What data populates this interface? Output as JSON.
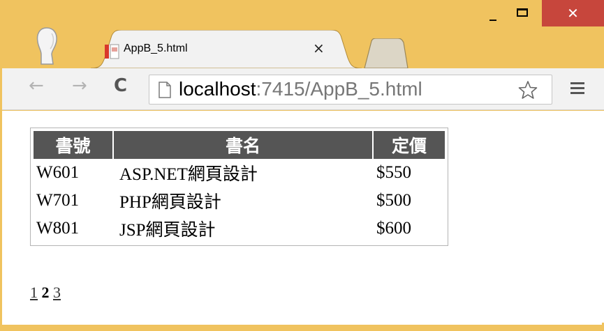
{
  "window": {
    "minimize_glyph": "_",
    "close_glyph": "✕",
    "colors": {
      "frame": "#f0c35f",
      "close": "#c7463c"
    }
  },
  "tab": {
    "title": "AppB_5.html",
    "close_glyph": "×",
    "favicon": "pdf-page-icon"
  },
  "toolbar": {
    "back_glyph": "←",
    "forward_glyph": "→",
    "reload_glyph": "C",
    "url_host": "localhost",
    "url_rest": ":7415/AppB_5.html",
    "star_icon": "bookmark-star-icon",
    "menu_icon": "hamburger-menu-icon"
  },
  "table": {
    "headers": [
      "書號",
      "書名",
      "定價"
    ],
    "rows": [
      [
        "W601",
        "ASP.NET網頁設計",
        "$550"
      ],
      [
        "W701",
        "PHP網頁設計",
        "$500"
      ],
      [
        "W801",
        "JSP網頁設計",
        "$600"
      ]
    ],
    "header_bg": "#555555"
  },
  "pager": {
    "pages": [
      "1",
      "2",
      "3"
    ],
    "current": "2"
  }
}
